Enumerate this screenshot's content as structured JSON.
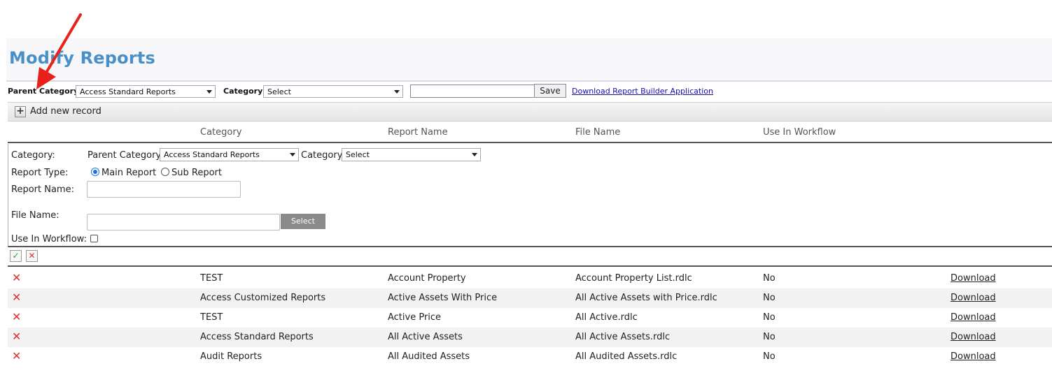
{
  "page": {
    "title": "Modify Reports"
  },
  "filter": {
    "parent_category_label": "Parent Category",
    "parent_category_value": "Access Standard Reports",
    "category_label": "Category",
    "category_value": "Select",
    "search_value": "",
    "save_label": "Save",
    "download_builder_link": "Download Report Builder Application"
  },
  "toolbar": {
    "add_label": "Add new record"
  },
  "table": {
    "columns": [
      "Category",
      "Report Name",
      "File Name",
      "Use In Workflow"
    ],
    "rows": [
      {
        "category": "TEST",
        "report_name": "Account Property",
        "file_name": "Account Property List.rdlc",
        "workflow": "No",
        "download": "Download"
      },
      {
        "category": "Access Customized Reports",
        "report_name": "Active Assets With Price",
        "file_name": "All Active Assets with Price.rdlc",
        "workflow": "No",
        "download": "Download"
      },
      {
        "category": "TEST",
        "report_name": "Active Price",
        "file_name": "All Active.rdlc",
        "workflow": "No",
        "download": "Download"
      },
      {
        "category": "Access Standard Reports",
        "report_name": "All Active Assets",
        "file_name": "All Active Assets.rdlc",
        "workflow": "No",
        "download": "Download"
      },
      {
        "category": "Audit Reports",
        "report_name": "All Audited Assets",
        "file_name": "All Audited Assets.rdlc",
        "workflow": "No",
        "download": "Download"
      }
    ]
  },
  "edit_form": {
    "category_label": "Category:",
    "parent_category_label": "Parent Category",
    "parent_category_value": "Access Standard Reports",
    "category_inner_label": "Category",
    "category_value": "Select",
    "report_type_label": "Report Type:",
    "main_report_label": "Main Report",
    "sub_report_label": "Sub Report",
    "selected_report_type": "Main Report",
    "report_name_label": "Report Name:",
    "report_name_value": "",
    "file_name_label": "File Name:",
    "file_name_value": "",
    "select_button_label": "Select",
    "use_in_workflow_label": "Use In Workflow:",
    "use_in_workflow_checked": false
  },
  "icons": {
    "add": "plus-icon",
    "confirm": "check-icon",
    "cancel": "close-icon",
    "delete": "delete-x-icon"
  },
  "colors": {
    "title": "#4a90c8",
    "link": "#1a0dab",
    "delete": "#e53030",
    "confirm": "#2e9e2e",
    "arrow": "#e8211c"
  }
}
